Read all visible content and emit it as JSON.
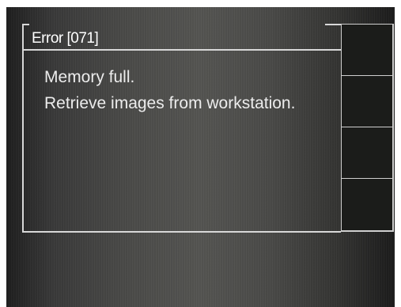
{
  "dialog": {
    "title": "Error [071]",
    "message_lines": [
      "Memory full.",
      "Retrieve images from workstation."
    ]
  },
  "softkeys": [
    {
      "label": ""
    },
    {
      "label": ""
    },
    {
      "label": ""
    },
    {
      "label": ""
    }
  ],
  "colors": {
    "frame_line": "#d8d8d8",
    "text": "#ececec",
    "softkey_bg": "#1b1c1a"
  }
}
